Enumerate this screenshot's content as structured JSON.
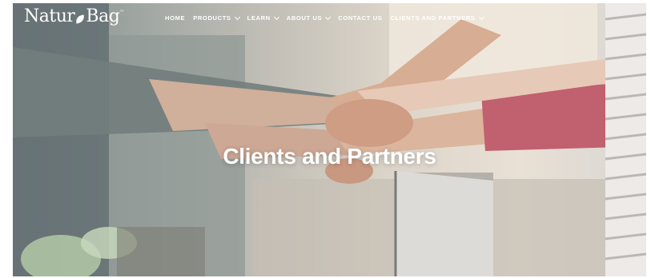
{
  "logo": {
    "text_left": "Natur",
    "text_right": "Bag",
    "tm": "™"
  },
  "nav": {
    "items": [
      {
        "label": "HOME",
        "dropdown": false
      },
      {
        "label": "PRODUCTS",
        "dropdown": true
      },
      {
        "label": "LEARN",
        "dropdown": true
      },
      {
        "label": "ABOUT US",
        "dropdown": true
      },
      {
        "label": "CONTACT US",
        "dropdown": false
      },
      {
        "label": "CLIENTS AND PARTNERS",
        "dropdown": true
      }
    ]
  },
  "hero": {
    "title": "Clients and Partners"
  },
  "colors": {
    "text": "#ffffff",
    "sleeve_red": "#b94a5c"
  }
}
